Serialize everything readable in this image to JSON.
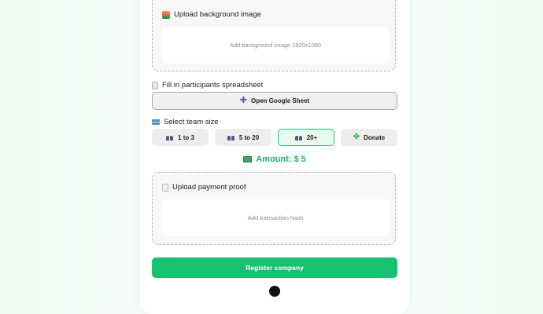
{
  "upload_background": {
    "title": "Upload background image",
    "placeholder": "Add background image 1920x1080"
  },
  "participants": {
    "label": "Fill in participants spreadsheet",
    "button_label": "Open Google Sheet"
  },
  "team_size": {
    "label": "Select team size",
    "options": [
      {
        "label": "1 to 3",
        "selected": false
      },
      {
        "label": "5 to 20",
        "selected": false
      },
      {
        "label": "20+",
        "selected": true
      }
    ],
    "donate_label": "Donate"
  },
  "amount": {
    "text": "Amount: $ 5"
  },
  "payment_proof": {
    "title": "Upload payment proof",
    "placeholder": "Add transaction hash"
  },
  "register": {
    "label": "Register company"
  },
  "colors": {
    "accent": "#16c172",
    "amount_text": "#20b066",
    "selected_border": "#22c074"
  }
}
